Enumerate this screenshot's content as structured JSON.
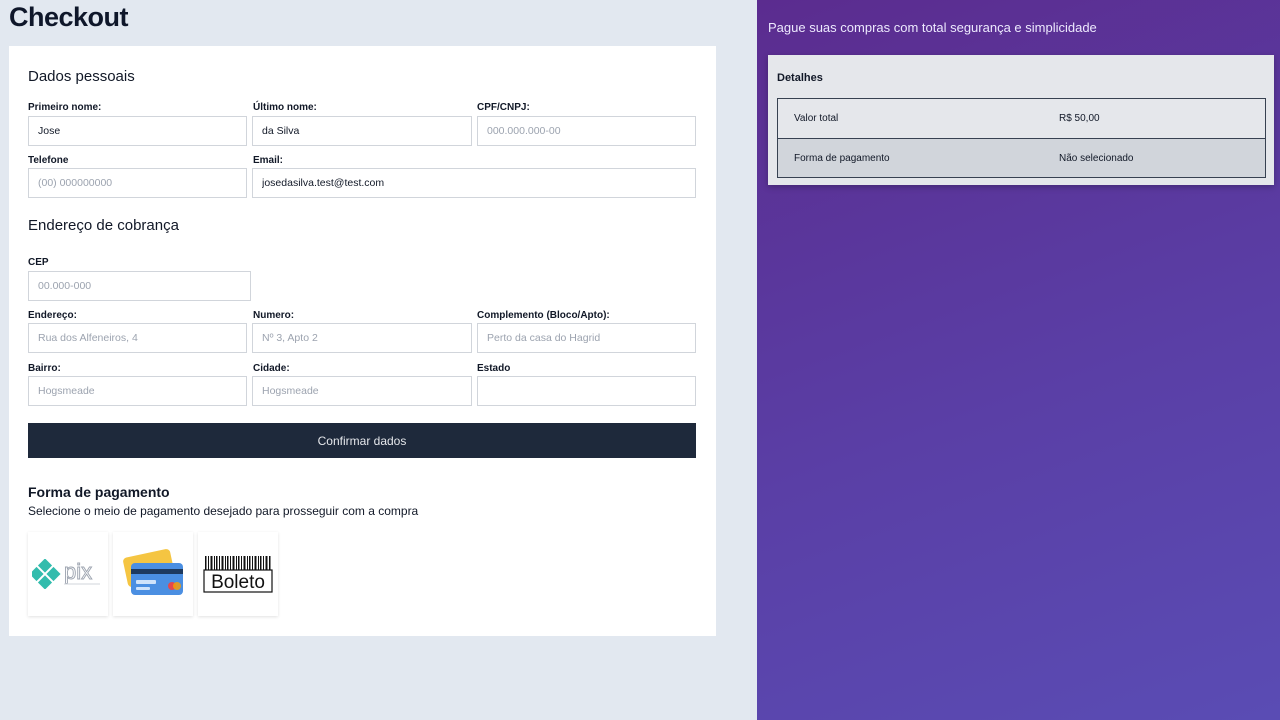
{
  "page_title": "Checkout",
  "personal": {
    "title": "Dados pessoais",
    "first_name": {
      "label": "Primeiro nome:",
      "value": "Jose",
      "placeholder": ""
    },
    "last_name": {
      "label": "Último nome:",
      "value": "da Silva",
      "placeholder": ""
    },
    "cpf": {
      "label": "CPF/CNPJ:",
      "value": "",
      "placeholder": "000.000.000-00"
    },
    "phone": {
      "label": "Telefone",
      "value": "",
      "placeholder": "(00) 000000000"
    },
    "email": {
      "label": "Email:",
      "value": "josedasilva.test@test.com",
      "placeholder": ""
    }
  },
  "billing": {
    "title": "Endereço de cobrança",
    "cep": {
      "label": "CEP",
      "value": "",
      "placeholder": "00.000-000"
    },
    "address": {
      "label": "Endereço:",
      "value": "",
      "placeholder": "Rua dos Alfeneiros, 4"
    },
    "number": {
      "label": "Numero:",
      "value": "",
      "placeholder": "Nº 3, Apto 2"
    },
    "complement": {
      "label": "Complemento (Bloco/Apto):",
      "value": "",
      "placeholder": "Perto da casa do Hagrid"
    },
    "district": {
      "label": "Bairro:",
      "value": "",
      "placeholder": "Hogsmeade"
    },
    "city": {
      "label": "Cidade:",
      "value": "",
      "placeholder": "Hogsmeade"
    },
    "state": {
      "label": "Estado",
      "value": "",
      "placeholder": ""
    }
  },
  "confirm_button": "Confirmar dados",
  "payment": {
    "title": "Forma de pagamento",
    "subtitle": "Selecione o meio de pagamento desejado para prosseguir com a compra",
    "options": [
      {
        "name": "pix",
        "label": "pix",
        "icon": "pix-logo-icon"
      },
      {
        "name": "card",
        "label": "",
        "icon": "credit-card-icon"
      },
      {
        "name": "boleto",
        "label": "Boleto",
        "icon": "barcode-icon"
      }
    ]
  },
  "summary": {
    "tagline": "Pague suas compras com total segurança e simplicidade",
    "title": "Detalhes",
    "rows": [
      {
        "label": "Valor total",
        "value": "R$ 50,00"
      },
      {
        "label": "Forma de pagamento",
        "value": "Não selecionado"
      }
    ]
  },
  "colors": {
    "button_bg": "#1e293b",
    "panel_gradient_start": "#5b2c8f",
    "panel_gradient_end": "#5a4cb4",
    "pix_teal": "#32bcad",
    "card_blue": "#4b8fe2",
    "card_yellow": "#f5c542"
  }
}
